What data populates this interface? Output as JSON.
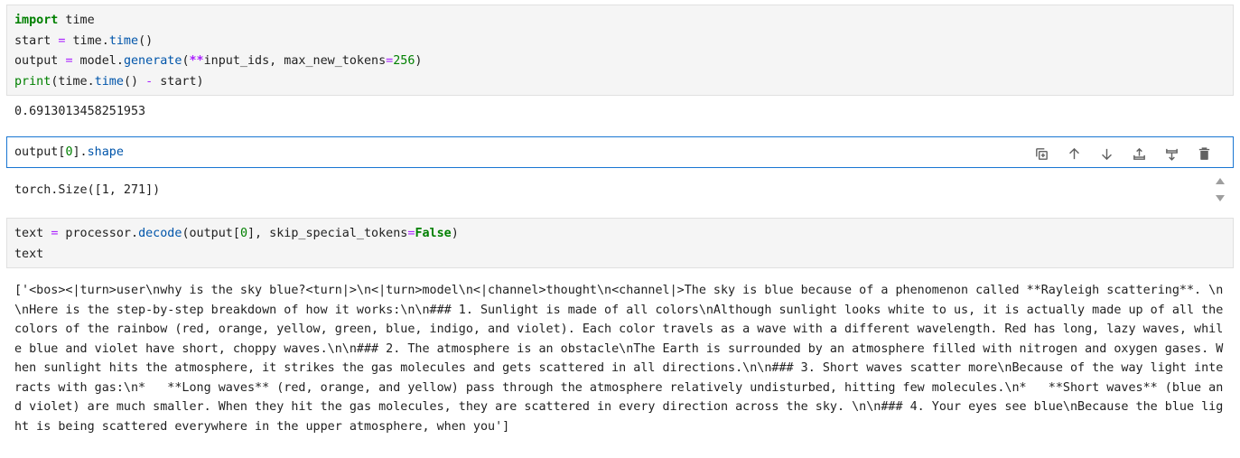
{
  "cell1": {
    "lines": {
      "l1_kw": "import",
      "l1_rest": " time",
      "l2_a": "start ",
      "l2_eq": "=",
      "l2_b": " time.",
      "l2_fn": "time",
      "l2_c": "()",
      "l3_a": "output ",
      "l3_eq": "=",
      "l3_b": " model.",
      "l3_fn": "generate",
      "l3_c": "(",
      "l3_op": "**",
      "l3_d": "input_ids, max_new_tokens",
      "l3_eq2": "=",
      "l3_num": "256",
      "l3_e": ")",
      "l4_kw": "print",
      "l4_a": "(time.",
      "l4_fn": "time",
      "l4_b": "() ",
      "l4_op": "-",
      "l4_c": " start)"
    },
    "output": "0.6913013458251953"
  },
  "cell2": {
    "code_a": "output[",
    "code_num": "0",
    "code_b": "].",
    "code_attr": "shape",
    "output": "torch.Size([1, 271])"
  },
  "cell3": {
    "l1_a": "text ",
    "l1_eq": "=",
    "l1_b": " processor.",
    "l1_fn": "decode",
    "l1_c": "(output[",
    "l1_num": "0",
    "l1_d": "], skip_special_tokens",
    "l1_eq2": "=",
    "l1_cst": "False",
    "l1_e": ")",
    "l2": "text",
    "output": "['<bos><|turn>user\\nwhy is the sky blue?<turn|>\\n<|turn>model\\n<|channel>thought\\n<channel|>The sky is blue because of a phenomenon called **Rayleigh scattering**. \\n\\nHere is the step-by-step breakdown of how it works:\\n\\n### 1. Sunlight is made of all colors\\nAlthough sunlight looks white to us, it is actually made up of all the colors of the rainbow (red, orange, yellow, green, blue, indigo, and violet). Each color travels as a wave with a different wavelength. Red has long, lazy waves, while blue and violet have short, choppy waves.\\n\\n### 2. The atmosphere is an obstacle\\nThe Earth is surrounded by an atmosphere filled with nitrogen and oxygen gases. When sunlight hits the atmosphere, it strikes the gas molecules and gets scattered in all directions.\\n\\n### 3. Short waves scatter more\\nBecause of the way light interacts with gas:\\n*   **Long waves** (red, orange, and yellow) pass through the atmosphere relatively undisturbed, hitting few molecules.\\n*   **Short waves** (blue and violet) are much smaller. When they hit the gas molecules, they are scattered in every direction across the sky. \\n\\n### 4. Your eyes see blue\\nBecause the blue light is being scattered everywhere in the upper atmosphere, when you']"
  },
  "toolbar": {
    "icons": [
      "duplicate-icon",
      "move-up-icon",
      "move-down-icon",
      "insert-above-icon",
      "insert-below-icon",
      "delete-icon"
    ]
  },
  "colors": {
    "active_border": "#1976d2",
    "cell_bg": "#f5f5f5",
    "keyword": "#008000",
    "function": "#0055aa",
    "operator": "#aa22ff"
  }
}
